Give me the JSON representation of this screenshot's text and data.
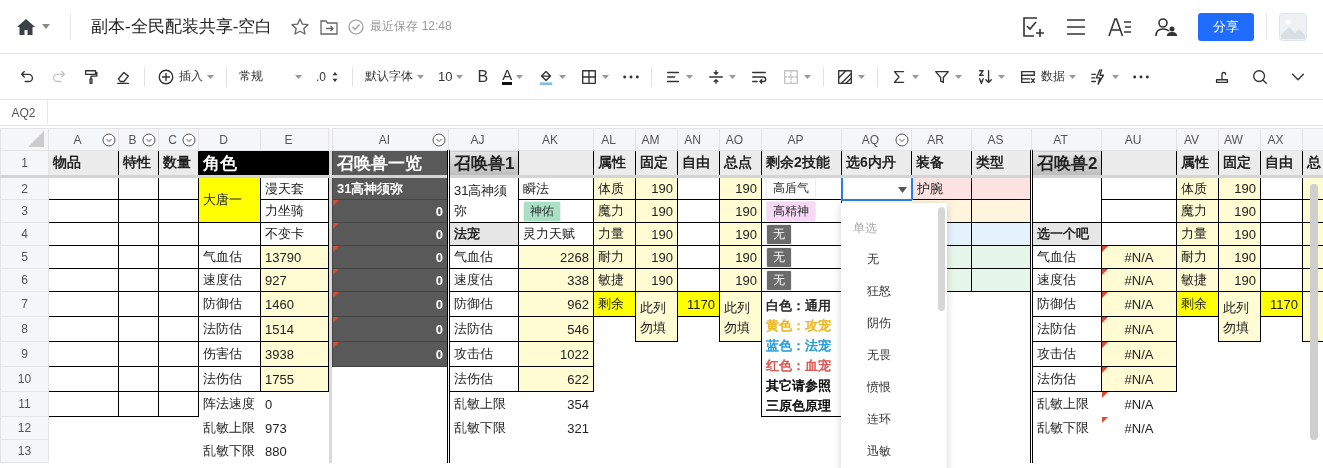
{
  "topbar": {
    "title": "副本-全民配装共享-空白",
    "save_status": "最近保存 12:48",
    "share_button": "分享"
  },
  "toolbar": {
    "groups": [
      [
        {
          "kind": "undo",
          "disabled": false
        },
        {
          "kind": "redo",
          "disabled": true
        },
        {
          "kind": "painter",
          "disabled": false
        },
        {
          "kind": "eraser",
          "disabled": false
        }
      ],
      [
        {
          "kind": "insert",
          "label": "插入",
          "disabled": false
        }
      ],
      [
        {
          "kind": "format",
          "label": "常规",
          "disabled": false
        },
        {
          "kind": "decimal",
          "label": ".0",
          "disabled": false
        }
      ],
      [
        {
          "kind": "font",
          "label": "默认字体",
          "disabled": false
        },
        {
          "kind": "size",
          "label": "10",
          "disabled": false
        },
        {
          "kind": "bold",
          "label": "B",
          "disabled": false
        },
        {
          "kind": "color",
          "label": "A",
          "disabled": false
        },
        {
          "kind": "fill",
          "disabled": false
        },
        {
          "kind": "border",
          "disabled": false
        },
        {
          "kind": "more",
          "disabled": false
        }
      ],
      [
        {
          "kind": "align",
          "disabled": false
        },
        {
          "kind": "valign",
          "disabled": false
        },
        {
          "kind": "wrap",
          "disabled": false
        },
        {
          "kind": "merge",
          "disabled": true
        }
      ],
      [
        {
          "kind": "cond",
          "disabled": false
        }
      ],
      [
        {
          "kind": "sum",
          "disabled": false
        },
        {
          "kind": "filter",
          "disabled": false
        },
        {
          "kind": "sort",
          "disabled": false
        },
        {
          "kind": "data",
          "label": "数据",
          "disabled": false
        },
        {
          "kind": "flash",
          "disabled": false
        },
        {
          "kind": "more",
          "disabled": false
        }
      ]
    ],
    "right": [
      {
        "kind": "brush",
        "disabled": false
      },
      {
        "kind": "search",
        "disabled": false
      },
      {
        "kind": "collapse",
        "disabled": false
      }
    ]
  },
  "name_box": "AQ2",
  "columns": [
    {
      "label": "A",
      "filter": true
    },
    {
      "label": "B",
      "filter": true
    },
    {
      "label": "C",
      "filter": true
    },
    {
      "label": "D",
      "filter": false
    },
    {
      "label": "E",
      "filter": false
    },
    {
      "label": "AI",
      "filter": true
    },
    {
      "label": "AJ",
      "filter": false
    },
    {
      "label": "AK",
      "filter": false
    },
    {
      "label": "AL",
      "filter": false
    },
    {
      "label": "AM",
      "filter": false
    },
    {
      "label": "AN",
      "filter": false
    },
    {
      "label": "AO",
      "filter": false
    },
    {
      "label": "AP",
      "filter": false
    },
    {
      "label": "AQ",
      "filter": true
    },
    {
      "label": "AR",
      "filter": false
    },
    {
      "label": "AS",
      "filter": false
    },
    {
      "label": "AT",
      "filter": false
    },
    {
      "label": "AU",
      "filter": false
    },
    {
      "label": "AV",
      "filter": false
    },
    {
      "label": "AW",
      "filter": false
    },
    {
      "label": "AX",
      "filter": false
    },
    {
      "filter": false
    }
  ],
  "rows": [
    {
      "number": "1",
      "cells": [
        {
          "kind": "head",
          "text": "物品"
        },
        {
          "kind": "head",
          "text": "特性"
        },
        {
          "kind": "head",
          "text": "数量"
        },
        {
          "kind": "black",
          "text": "角色"
        },
        {
          "kind": "merged"
        },
        {
          "kind": "darktitle",
          "text": "召唤兽一览"
        },
        {
          "kind": "title",
          "text": "召唤兽1"
        },
        {
          "kind": "head"
        },
        {
          "kind": "head",
          "text": "属性"
        },
        {
          "kind": "head",
          "text": "固定"
        },
        {
          "kind": "head",
          "text": "自由"
        },
        {
          "kind": "head",
          "text": "总点"
        },
        {
          "kind": "head",
          "text": "剩余2技能"
        },
        {
          "kind": "head",
          "text": "选6内丹"
        },
        {
          "kind": "head",
          "text": "装备"
        },
        {
          "kind": "head",
          "text": "类型"
        },
        {
          "kind": "title",
          "text": "召唤兽2"
        },
        {
          "kind": "head"
        },
        {
          "kind": "head",
          "text": "属性"
        },
        {
          "kind": "head",
          "text": "固定"
        },
        {
          "kind": "head",
          "text": "自由"
        },
        {
          "kind": "head",
          "text": "总"
        }
      ]
    },
    {
      "number": "2",
      "cells": [
        {
          "kind": "cell"
        },
        {
          "kind": "cell"
        },
        {
          "kind": "cell"
        },
        {
          "kind": "yellow",
          "text": "大唐一"
        },
        {
          "kind": "cell",
          "text": "漫天套"
        },
        {
          "kind": "dark",
          "text": "31高神须弥"
        },
        {
          "kind": "cellwrap",
          "text": "31高神须弥"
        },
        {
          "kind": "cell",
          "text": "瞬法"
        },
        {
          "kind": "cream",
          "text": "体质"
        },
        {
          "kind": "creamnum",
          "text": "190"
        },
        {
          "kind": "cell"
        },
        {
          "kind": "creamnum",
          "text": "190"
        },
        {
          "kind": "chip",
          "text": "高盾气",
          "color": "#ffffff"
        },
        {
          "kind": "active"
        },
        {
          "kind": "pink",
          "text": "护腕"
        },
        {
          "kind": "pink"
        },
        {
          "kind": "cell"
        },
        {
          "kind": "cell"
        },
        {
          "kind": "cream",
          "text": "体质"
        },
        {
          "kind": "creamnum",
          "text": "190"
        },
        {
          "kind": "cell"
        },
        {
          "kind": "cream"
        }
      ]
    },
    {
      "number": "3",
      "cells": [
        {
          "kind": "cell"
        },
        {
          "kind": "cell"
        },
        {
          "kind": "cell"
        },
        {
          "kind": "merged"
        },
        {
          "kind": "cell",
          "text": "力坐骑"
        },
        {
          "kind": "darknote",
          "text": "0"
        },
        {
          "kind": "merged"
        },
        {
          "kind": "chip",
          "text": "神佑",
          "color": "#a8dfc5"
        },
        {
          "kind": "cream",
          "text": "魔力"
        },
        {
          "kind": "creamnum",
          "text": "190"
        },
        {
          "kind": "cell"
        },
        {
          "kind": "creamnum",
          "text": "190"
        },
        {
          "kind": "chip",
          "text": "高精神",
          "color": "#f7d9f7"
        },
        {
          "kind": "free"
        },
        {
          "kind": "peach"
        },
        {
          "kind": "peach"
        },
        {
          "kind": "merged"
        },
        {
          "kind": "cell"
        },
        {
          "kind": "cream",
          "text": "魔力"
        },
        {
          "kind": "creamnum",
          "text": "190"
        },
        {
          "kind": "cell"
        },
        {
          "kind": "cream"
        }
      ]
    },
    {
      "number": "4",
      "cells": [
        {
          "kind": "cell"
        },
        {
          "kind": "cell"
        },
        {
          "kind": "cell"
        },
        {
          "kind": "cell"
        },
        {
          "kind": "cell",
          "text": "不变卡"
        },
        {
          "kind": "darknote",
          "text": "0"
        },
        {
          "kind": "grey",
          "text": "法宠"
        },
        {
          "kind": "cell",
          "text": "灵力天赋"
        },
        {
          "kind": "cream",
          "text": "力量"
        },
        {
          "kind": "creamnum",
          "text": "190"
        },
        {
          "kind": "cell"
        },
        {
          "kind": "creamnum",
          "text": "190"
        },
        {
          "kind": "chip",
          "text": "无",
          "color": "#6b6b6b"
        },
        {
          "kind": "free"
        },
        {
          "kind": "blue"
        },
        {
          "kind": "blue"
        },
        {
          "kind": "grey",
          "text": "选一个吧"
        },
        {
          "kind": "cell"
        },
        {
          "kind": "cream",
          "text": "力量"
        },
        {
          "kind": "creamnum",
          "text": "190"
        },
        {
          "kind": "cell"
        },
        {
          "kind": "cream"
        }
      ]
    },
    {
      "number": "5",
      "cells": [
        {
          "kind": "cell"
        },
        {
          "kind": "cell"
        },
        {
          "kind": "cell"
        },
        {
          "kind": "cell",
          "text": "气血估"
        },
        {
          "kind": "cream",
          "text": "13790"
        },
        {
          "kind": "darknote",
          "text": "0"
        },
        {
          "kind": "cell",
          "text": "气血估"
        },
        {
          "kind": "creamnum",
          "text": "2268"
        },
        {
          "kind": "cream",
          "text": "耐力"
        },
        {
          "kind": "creamnum",
          "text": "190"
        },
        {
          "kind": "cell"
        },
        {
          "kind": "creamnum",
          "text": "190"
        },
        {
          "kind": "chip",
          "text": "无",
          "color": "#6b6b6b"
        },
        {
          "kind": "free"
        },
        {
          "kind": "green"
        },
        {
          "kind": "green"
        },
        {
          "kind": "cell",
          "text": "气血估"
        },
        {
          "kind": "na",
          "text": "#N/A"
        },
        {
          "kind": "cream",
          "text": "耐力"
        },
        {
          "kind": "creamnum",
          "text": "190"
        },
        {
          "kind": "cell"
        },
        {
          "kind": "cream"
        }
      ]
    },
    {
      "number": "6",
      "cells": [
        {
          "kind": "cell"
        },
        {
          "kind": "cell"
        },
        {
          "kind": "cell"
        },
        {
          "kind": "cell",
          "text": "速度估"
        },
        {
          "kind": "cream",
          "text": "927"
        },
        {
          "kind": "darknote",
          "text": "0"
        },
        {
          "kind": "cell",
          "text": "速度估"
        },
        {
          "kind": "creamnum",
          "text": "338"
        },
        {
          "kind": "cream",
          "text": "敏捷"
        },
        {
          "kind": "creamnum",
          "text": "190"
        },
        {
          "kind": "cell"
        },
        {
          "kind": "creamnum",
          "text": "190"
        },
        {
          "kind": "chip",
          "text": "无",
          "color": "#6b6b6b"
        },
        {
          "kind": "free"
        },
        {
          "kind": "green"
        },
        {
          "kind": "green"
        },
        {
          "kind": "cell",
          "text": "速度估"
        },
        {
          "kind": "na",
          "text": "#N/A"
        },
        {
          "kind": "cream",
          "text": "敏捷"
        },
        {
          "kind": "creamnum",
          "text": "190"
        },
        {
          "kind": "cell"
        },
        {
          "kind": "cream"
        }
      ]
    },
    {
      "number": "7",
      "cells": [
        {
          "kind": "cell"
        },
        {
          "kind": "cell"
        },
        {
          "kind": "cell"
        },
        {
          "kind": "cell",
          "text": "防御估"
        },
        {
          "kind": "cream",
          "text": "1460"
        },
        {
          "kind": "darknote",
          "text": "0"
        },
        {
          "kind": "cell",
          "text": "防御估"
        },
        {
          "kind": "creamnum",
          "text": "962"
        },
        {
          "kind": "yellow",
          "text": "剩余"
        },
        {
          "kind": "note",
          "text": "此列勿填"
        },
        {
          "kind": "yellownum",
          "text": "1170"
        },
        {
          "kind": "note",
          "text": "此列勿填"
        },
        {
          "kind": "legend",
          "lines": [
            {
              "text": "白色：通用",
              "color": "#222222"
            },
            {
              "text": "黄色：攻宠",
              "color": "#eeb31a"
            },
            {
              "text": "蓝色：法宠",
              "color": "#1d9ad6"
            },
            {
              "text": "红色：血宠",
              "color": "#d9534f"
            },
            {
              "text": "其它请参照",
              "color": "#000000"
            },
            {
              "text": "三原色原理",
              "color": "#000000"
            }
          ]
        },
        {
          "kind": "free"
        },
        {
          "kind": "free"
        },
        {
          "kind": "free"
        },
        {
          "kind": "cell",
          "text": "防御估"
        },
        {
          "kind": "na",
          "text": "#N/A"
        },
        {
          "kind": "yellow",
          "text": "剩余"
        },
        {
          "kind": "note",
          "text": "此列勿填"
        },
        {
          "kind": "yellownum",
          "text": "1170"
        },
        {
          "kind": "cream"
        }
      ]
    },
    {
      "number": "8",
      "cells": [
        {
          "kind": "cell"
        },
        {
          "kind": "cell"
        },
        {
          "kind": "cell"
        },
        {
          "kind": "cell",
          "text": "法防估"
        },
        {
          "kind": "cream",
          "text": "1514"
        },
        {
          "kind": "darknote",
          "text": "0"
        },
        {
          "kind": "cell",
          "text": "法防估"
        },
        {
          "kind": "creamnum",
          "text": "546"
        },
        {
          "kind": "free"
        },
        {
          "kind": "merged"
        },
        {
          "kind": "free"
        },
        {
          "kind": "merged"
        },
        {
          "kind": "merged"
        },
        {
          "kind": "free"
        },
        {
          "kind": "free"
        },
        {
          "kind": "free"
        },
        {
          "kind": "cell",
          "text": "法防估"
        },
        {
          "kind": "na",
          "text": "#N/A"
        },
        {
          "kind": "free"
        },
        {
          "kind": "merged"
        },
        {
          "kind": "free"
        },
        {
          "kind": "merged"
        }
      ]
    },
    {
      "number": "9",
      "cells": [
        {
          "kind": "cell"
        },
        {
          "kind": "cell"
        },
        {
          "kind": "cell"
        },
        {
          "kind": "cell",
          "text": "伤害估"
        },
        {
          "kind": "cream",
          "text": "3938"
        },
        {
          "kind": "darknote",
          "text": "0"
        },
        {
          "kind": "cell",
          "text": "攻击估"
        },
        {
          "kind": "creamnum",
          "text": "1022"
        },
        {
          "kind": "free"
        },
        {
          "kind": "free"
        },
        {
          "kind": "free"
        },
        {
          "kind": "free"
        },
        {
          "kind": "merged"
        },
        {
          "kind": "free"
        },
        {
          "kind": "free"
        },
        {
          "kind": "free"
        },
        {
          "kind": "cell",
          "text": "攻击估"
        },
        {
          "kind": "na",
          "text": "#N/A"
        },
        {
          "kind": "free"
        },
        {
          "kind": "free"
        },
        {
          "kind": "free"
        },
        {
          "kind": "free"
        }
      ]
    },
    {
      "number": "10",
      "cells": [
        {
          "kind": "cell"
        },
        {
          "kind": "cell"
        },
        {
          "kind": "cell"
        },
        {
          "kind": "cell",
          "text": "法伤估"
        },
        {
          "kind": "cream",
          "text": "1755"
        },
        {
          "kind": "free"
        },
        {
          "kind": "cell",
          "text": "法伤估"
        },
        {
          "kind": "creamnum",
          "text": "622"
        },
        {
          "kind": "free"
        },
        {
          "kind": "free"
        },
        {
          "kind": "free"
        },
        {
          "kind": "free"
        },
        {
          "kind": "merged"
        },
        {
          "kind": "free"
        },
        {
          "kind": "free"
        },
        {
          "kind": "free"
        },
        {
          "kind": "cell",
          "text": "法伤估"
        },
        {
          "kind": "na",
          "text": "#N/A"
        },
        {
          "kind": "free"
        },
        {
          "kind": "free"
        },
        {
          "kind": "free"
        },
        {
          "kind": "free"
        }
      ]
    },
    {
      "number": "11",
      "cells": [
        {
          "kind": "cell"
        },
        {
          "kind": "cell"
        },
        {
          "kind": "cell"
        },
        {
          "kind": "free",
          "text": "阵法速度"
        },
        {
          "kind": "free",
          "text": "0"
        },
        {
          "kind": "free"
        },
        {
          "kind": "free",
          "text": "乱敏上限"
        },
        {
          "kind": "freenum",
          "text": "354"
        },
        {
          "kind": "free"
        },
        {
          "kind": "free"
        },
        {
          "kind": "free"
        },
        {
          "kind": "free"
        },
        {
          "kind": "merged"
        },
        {
          "kind": "free"
        },
        {
          "kind": "free"
        },
        {
          "kind": "free"
        },
        {
          "kind": "free",
          "text": "乱敏上限"
        },
        {
          "kind": "freena",
          "text": "#N/A"
        },
        {
          "kind": "free"
        },
        {
          "kind": "free"
        },
        {
          "kind": "free"
        },
        {
          "kind": "free"
        }
      ]
    },
    {
      "number": "12",
      "cells": [
        {
          "kind": "free"
        },
        {
          "kind": "free"
        },
        {
          "kind": "free"
        },
        {
          "kind": "free",
          "text": "乱敏上限"
        },
        {
          "kind": "free",
          "text": "973"
        },
        {
          "kind": "free"
        },
        {
          "kind": "free",
          "text": "乱敏下限"
        },
        {
          "kind": "freenum",
          "text": "321"
        },
        {
          "kind": "free"
        },
        {
          "kind": "free"
        },
        {
          "kind": "free"
        },
        {
          "kind": "free"
        },
        {
          "kind": "free"
        },
        {
          "kind": "free"
        },
        {
          "kind": "free"
        },
        {
          "kind": "free"
        },
        {
          "kind": "free",
          "text": "乱敏下限"
        },
        {
          "kind": "freena",
          "text": "#N/A"
        },
        {
          "kind": "free"
        },
        {
          "kind": "free"
        },
        {
          "kind": "free"
        },
        {
          "kind": "free"
        }
      ]
    },
    {
      "number": "13",
      "cells": [
        {
          "kind": "free"
        },
        {
          "kind": "free"
        },
        {
          "kind": "free"
        },
        {
          "kind": "free",
          "text": "乱敏下限"
        },
        {
          "kind": "free",
          "text": "880"
        },
        {
          "kind": "free"
        },
        {
          "kind": "free"
        },
        {
          "kind": "free"
        },
        {
          "kind": "free"
        },
        {
          "kind": "free"
        },
        {
          "kind": "free"
        },
        {
          "kind": "free"
        },
        {
          "kind": "free"
        },
        {
          "kind": "free"
        },
        {
          "kind": "free"
        },
        {
          "kind": "free"
        },
        {
          "kind": "free"
        },
        {
          "kind": "free"
        },
        {
          "kind": "free"
        },
        {
          "kind": "free"
        },
        {
          "kind": "free"
        },
        {
          "kind": "free"
        }
      ]
    }
  ],
  "dropdown": {
    "header": "单选",
    "options": [
      "无",
      "狂怒",
      "阴伤",
      "无畏",
      "愤恨",
      "连环",
      "迅敏"
    ]
  }
}
